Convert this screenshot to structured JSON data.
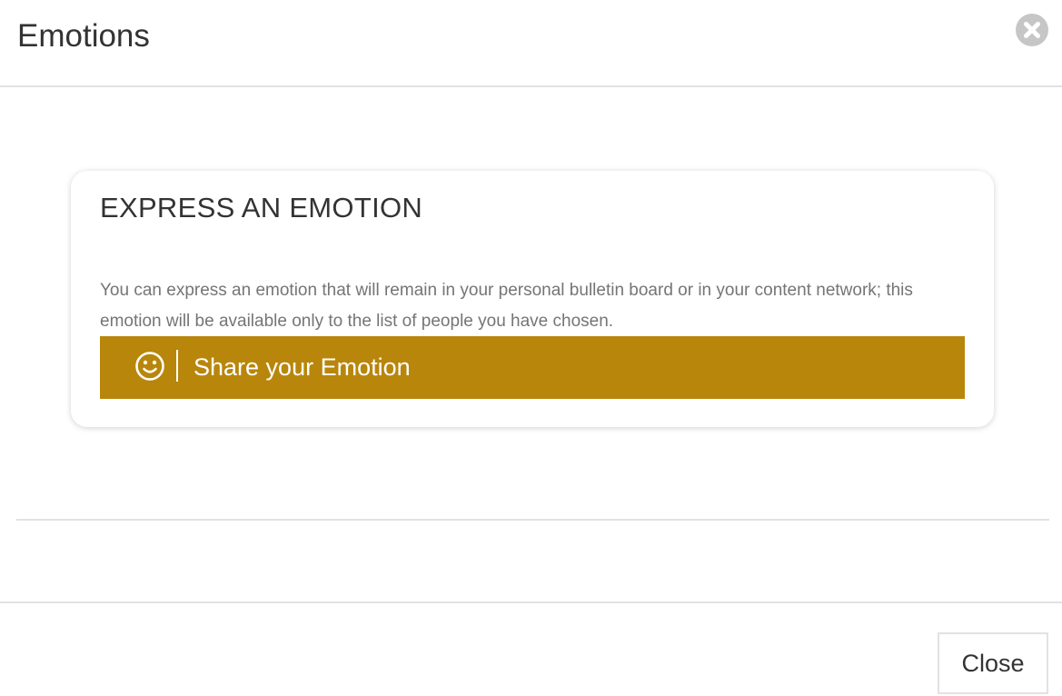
{
  "dialog": {
    "title": "Emotions",
    "close_icon": "close-circle-icon"
  },
  "card": {
    "heading": "EXPRESS AN EMOTION",
    "description": "You can express an emotion that will remain in your personal bulletin board or in your content network; this emotion will be available only to the list of people you have chosen.",
    "share_button": {
      "icon": "smiley-icon",
      "label": "Share your Emotion",
      "color": "#b8860b"
    }
  },
  "footer": {
    "close_label": "Close"
  }
}
